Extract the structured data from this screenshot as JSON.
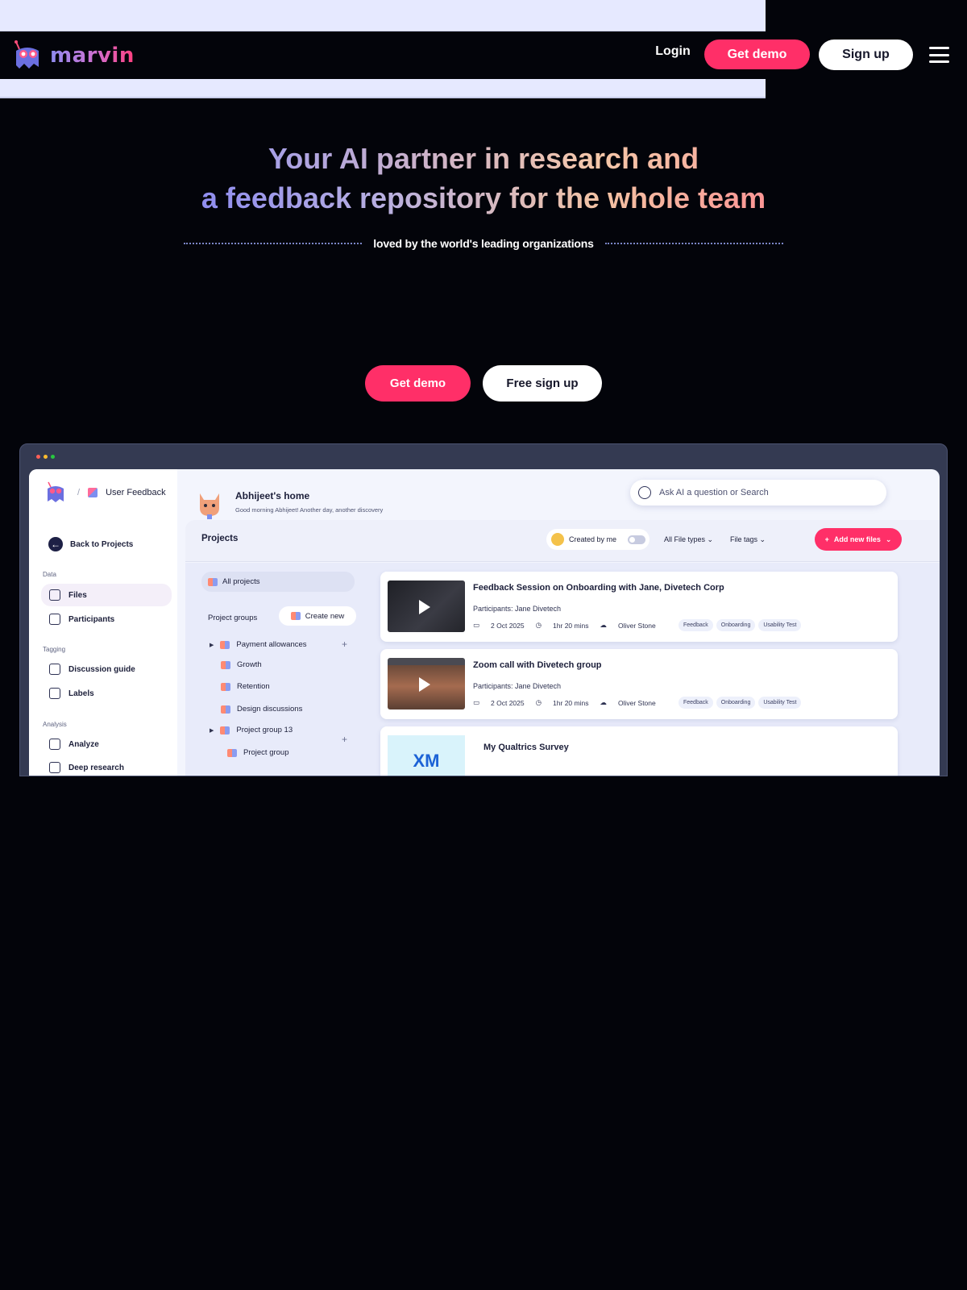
{
  "brand": {
    "name": "marvin",
    "accent": "#ff2f68"
  },
  "nav": {
    "login": "Login",
    "get_demo": "Get demo",
    "sign_up": "Sign up",
    "menu_icon": "hamburger-icon"
  },
  "hero": {
    "line1": [
      "Your AI partner in research and"
    ],
    "line2": [
      "a feedback repository for the whole team"
    ],
    "tagline": "loved by the world's leading organizations"
  },
  "cta": {
    "get_demo": "Get demo",
    "free_sign_up": "Free sign up"
  },
  "app": {
    "breadcrumb": "User Feedback",
    "back": "Back to Projects",
    "sections": {
      "data": "Data",
      "tagging": "Tagging",
      "analysis": "Analysis"
    },
    "nav_items": [
      "Files",
      "Participants",
      "Discussion guide",
      "Labels",
      "Analyze",
      "Deep research"
    ],
    "home_title": "Abhijeet's home",
    "home_subtitle": "Good morning Abhijeet! Another day, another discovery",
    "search_placeholder": "Ask AI a question or Search",
    "projects_title": "Projects",
    "created_by_me": "Created by me",
    "all_file_types": "All File types",
    "file_tags": "File tags",
    "add_new_files": "Add new files",
    "all_projects": "All projects",
    "project_groups": "Project groups",
    "create_new": "Create new",
    "tree": [
      "Payment allowances",
      "Growth",
      "Retention",
      "Design discussions",
      "Project group 13",
      "Project group"
    ],
    "cards": [
      {
        "title": "Feedback Session on Onboarding with Jane, Divetech Corp",
        "participants": "Participants: Jane Divetech",
        "date": "2 Oct 2025",
        "duration": "1hr 20 mins",
        "owner": "Oliver Stone",
        "tags": [
          "Feedback",
          "Onboarding",
          "Usability Test"
        ]
      },
      {
        "title": "Zoom call with Divetech group",
        "participants": "Participants: Jane Divetech",
        "date": "2 Oct 2025",
        "duration": "1hr 20 mins",
        "owner": "Oliver Stone",
        "tags": [
          "Feedback",
          "Onboarding",
          "Usability Test"
        ]
      },
      {
        "title": "My Qualtrics Survey",
        "thumb_text": "XM"
      }
    ]
  }
}
